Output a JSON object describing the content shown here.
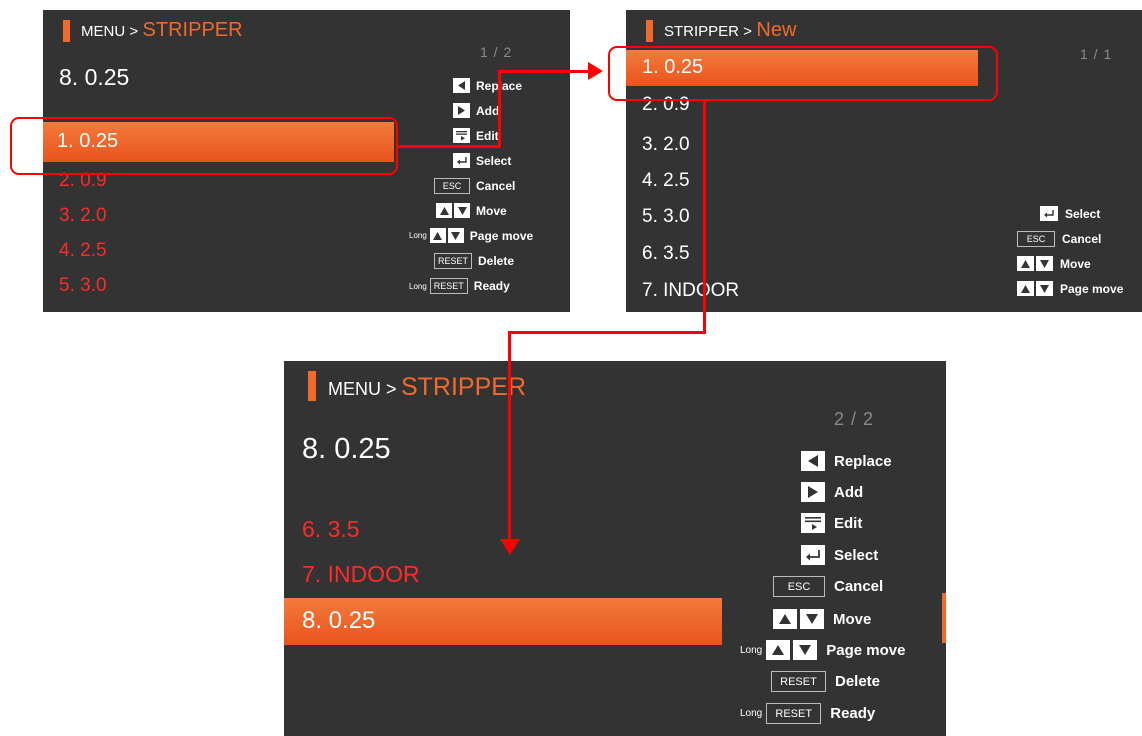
{
  "panel1": {
    "breadcrumb_lead": "MENU >",
    "breadcrumb_current": "STRIPPER",
    "page": "1 / 2",
    "current_setting": "8. 0.25",
    "selected_item": "1. 0.25",
    "items": [
      "2. 0.9",
      "3. 2.0",
      "4. 2.5",
      "5. 3.0"
    ],
    "help": {
      "replace": "Replace",
      "add": "Add",
      "edit": "Edit",
      "select": "Select",
      "cancel": "Cancel",
      "move": "Move",
      "page_move": "Page move",
      "delete": "Delete",
      "ready": "Ready"
    }
  },
  "panel2": {
    "breadcrumb_lead": "STRIPPER >",
    "breadcrumb_current": "New",
    "page": "1 / 1",
    "selected_item": "1. 0.25",
    "items": [
      "2. 0.9",
      "3. 2.0",
      "4. 2.5",
      "5. 3.0",
      "6. 3.5",
      "7. INDOOR"
    ],
    "help": {
      "select": "Select",
      "cancel": "Cancel",
      "move": "Move",
      "page_move": "Page move"
    }
  },
  "panel3": {
    "breadcrumb_lead": "MENU >",
    "breadcrumb_current": "STRIPPER",
    "page": "2 / 2",
    "current_setting": "8. 0.25",
    "items": [
      "6. 3.5",
      "7. INDOOR"
    ],
    "selected_item": "8. 0.25",
    "help": {
      "replace": "Replace",
      "add": "Add",
      "edit": "Edit",
      "select": "Select",
      "cancel": "Cancel",
      "move": "Move",
      "page_move": "Page move",
      "delete": "Delete",
      "ready": "Ready"
    }
  },
  "keys": {
    "esc": "ESC",
    "reset": "RESET",
    "long": "Long"
  },
  "icons": {
    "left": "arrow-left-key-icon",
    "right": "arrow-right-key-icon",
    "edit": "edit-key-icon",
    "enter": "enter-key-icon",
    "up": "arrow-up-key-icon",
    "down": "arrow-down-key-icon"
  },
  "colors": {
    "screen_bg": "#333333",
    "accent": "#f26a2b",
    "item_red": "#ff2a2a",
    "callout": "#ff0000"
  }
}
